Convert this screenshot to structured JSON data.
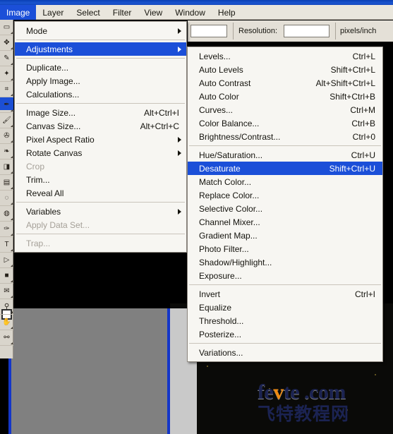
{
  "app": {
    "title": "Adobe Photoshop",
    "theme_accent": "#1b4fd8",
    "menu_bg": "#f7f6f2",
    "bar_bg": "#e9e6dd"
  },
  "menubar": {
    "items": [
      {
        "label": "Image",
        "active": true
      },
      {
        "label": "Layer",
        "active": false
      },
      {
        "label": "Select",
        "active": false
      },
      {
        "label": "Filter",
        "active": false
      },
      {
        "label": "View",
        "active": false
      },
      {
        "label": "Window",
        "active": false
      },
      {
        "label": "Help",
        "active": false
      }
    ]
  },
  "options_bar": {
    "width_value": "",
    "resolution_label": "Resolution:",
    "resolution_value": "",
    "resolution_units": "pixels/inch"
  },
  "image_menu": {
    "name": "Image",
    "items": [
      {
        "label": "Mode",
        "accel": "",
        "submenu": true,
        "disabled": false,
        "highlight": false
      },
      {
        "type": "separator"
      },
      {
        "label": "Adjustments",
        "accel": "",
        "submenu": true,
        "disabled": false,
        "highlight": true
      },
      {
        "type": "separator"
      },
      {
        "label": "Duplicate...",
        "accel": "",
        "submenu": false,
        "disabled": false,
        "highlight": false
      },
      {
        "label": "Apply Image...",
        "accel": "",
        "submenu": false,
        "disabled": false,
        "highlight": false
      },
      {
        "label": "Calculations...",
        "accel": "",
        "submenu": false,
        "disabled": false,
        "highlight": false
      },
      {
        "type": "separator"
      },
      {
        "label": "Image Size...",
        "accel": "Alt+Ctrl+I",
        "submenu": false,
        "disabled": false,
        "highlight": false
      },
      {
        "label": "Canvas Size...",
        "accel": "Alt+Ctrl+C",
        "submenu": false,
        "disabled": false,
        "highlight": false
      },
      {
        "label": "Pixel Aspect Ratio",
        "accel": "",
        "submenu": true,
        "disabled": false,
        "highlight": false
      },
      {
        "label": "Rotate Canvas",
        "accel": "",
        "submenu": true,
        "disabled": false,
        "highlight": false
      },
      {
        "label": "Crop",
        "accel": "",
        "submenu": false,
        "disabled": true,
        "highlight": false
      },
      {
        "label": "Trim...",
        "accel": "",
        "submenu": false,
        "disabled": false,
        "highlight": false
      },
      {
        "label": "Reveal All",
        "accel": "",
        "submenu": false,
        "disabled": false,
        "highlight": false
      },
      {
        "type": "separator"
      },
      {
        "label": "Variables",
        "accel": "",
        "submenu": true,
        "disabled": false,
        "highlight": false
      },
      {
        "label": "Apply Data Set...",
        "accel": "",
        "submenu": false,
        "disabled": true,
        "highlight": false
      },
      {
        "type": "separator"
      },
      {
        "label": "Trap...",
        "accel": "",
        "submenu": false,
        "disabled": true,
        "highlight": false
      }
    ]
  },
  "adjustments_submenu": {
    "name": "Adjustments",
    "items": [
      {
        "label": "Levels...",
        "accel": "Ctrl+L",
        "disabled": false,
        "highlight": false
      },
      {
        "label": "Auto Levels",
        "accel": "Shift+Ctrl+L",
        "disabled": false,
        "highlight": false
      },
      {
        "label": "Auto Contrast",
        "accel": "Alt+Shift+Ctrl+L",
        "disabled": false,
        "highlight": false
      },
      {
        "label": "Auto Color",
        "accel": "Shift+Ctrl+B",
        "disabled": false,
        "highlight": false
      },
      {
        "label": "Curves...",
        "accel": "Ctrl+M",
        "disabled": false,
        "highlight": false
      },
      {
        "label": "Color Balance...",
        "accel": "Ctrl+B",
        "disabled": false,
        "highlight": false
      },
      {
        "label": "Brightness/Contrast...",
        "accel": "Ctrl+0",
        "disabled": false,
        "highlight": false
      },
      {
        "type": "separator"
      },
      {
        "label": "Hue/Saturation...",
        "accel": "Ctrl+U",
        "disabled": false,
        "highlight": false
      },
      {
        "label": "Desaturate",
        "accel": "Shift+Ctrl+U",
        "disabled": false,
        "highlight": true
      },
      {
        "label": "Match Color...",
        "accel": "",
        "disabled": false,
        "highlight": false
      },
      {
        "label": "Replace Color...",
        "accel": "",
        "disabled": false,
        "highlight": false
      },
      {
        "label": "Selective Color...",
        "accel": "",
        "disabled": false,
        "highlight": false
      },
      {
        "label": "Channel Mixer...",
        "accel": "",
        "disabled": false,
        "highlight": false
      },
      {
        "label": "Gradient Map...",
        "accel": "",
        "disabled": false,
        "highlight": false
      },
      {
        "label": "Photo Filter...",
        "accel": "",
        "disabled": false,
        "highlight": false
      },
      {
        "label": "Shadow/Highlight...",
        "accel": "",
        "disabled": false,
        "highlight": false
      },
      {
        "label": "Exposure...",
        "accel": "",
        "disabled": false,
        "highlight": false
      },
      {
        "type": "separator"
      },
      {
        "label": "Invert",
        "accel": "Ctrl+I",
        "disabled": false,
        "highlight": false
      },
      {
        "label": "Equalize",
        "accel": "",
        "disabled": false,
        "highlight": false
      },
      {
        "label": "Threshold...",
        "accel": "",
        "disabled": false,
        "highlight": false
      },
      {
        "label": "Posterize...",
        "accel": "",
        "disabled": false,
        "highlight": false
      },
      {
        "type": "separator"
      },
      {
        "label": "Variations...",
        "accel": "",
        "disabled": false,
        "highlight": false
      }
    ]
  },
  "toolbar": {
    "tools": [
      {
        "name": "marquee-tool",
        "glyph": "▭"
      },
      {
        "name": "move-tool",
        "glyph": "✥"
      },
      {
        "name": "lasso-tool",
        "glyph": "✎"
      },
      {
        "name": "magic-wand-tool",
        "glyph": "✦"
      },
      {
        "name": "crop-tool",
        "glyph": "⌗"
      },
      {
        "name": "healing-brush-tool",
        "glyph": "✒"
      },
      {
        "name": "brush-tool",
        "glyph": "🖌"
      },
      {
        "name": "stamp-tool",
        "glyph": "✇"
      },
      {
        "name": "history-brush-tool",
        "glyph": "❧"
      },
      {
        "name": "eraser-tool",
        "glyph": "◨"
      },
      {
        "name": "gradient-tool",
        "glyph": "▤"
      },
      {
        "name": "blur-tool",
        "glyph": "◌"
      },
      {
        "name": "dodge-tool",
        "glyph": "◍"
      },
      {
        "name": "pen-tool",
        "glyph": "✑"
      },
      {
        "name": "type-tool",
        "glyph": "T"
      },
      {
        "name": "path-selection-tool",
        "glyph": "▷"
      },
      {
        "name": "shape-tool",
        "glyph": "■"
      },
      {
        "name": "notes-tool",
        "glyph": "✉"
      },
      {
        "name": "eyedropper-tool",
        "glyph": "⚲"
      },
      {
        "name": "hand-tool",
        "glyph": "✋"
      },
      {
        "name": "zoom-tool",
        "glyph": "⚯"
      }
    ]
  },
  "watermark": {
    "latin_pre": "fe",
    "latin_v": "v",
    "latin_post": "te .com",
    "chinese": "飞特教程网"
  }
}
